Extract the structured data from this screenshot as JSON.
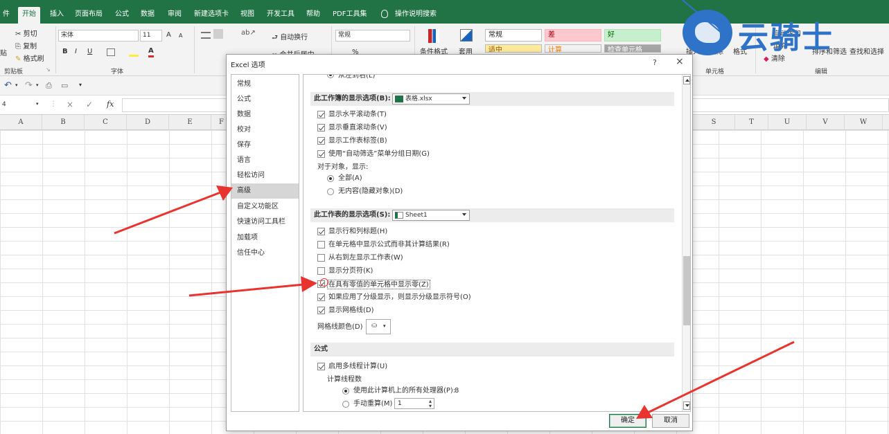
{
  "tabs": [
    "件",
    "开始",
    "插入",
    "页面布局",
    "公式",
    "数据",
    "审阅",
    "新建选项卡",
    "视图",
    "开发工具",
    "帮助",
    "PDF工具集",
    "操作说明搜索"
  ],
  "ribbon": {
    "clipboard": {
      "cut": "剪切",
      "copy": "复制",
      "paint": "格式刷",
      "paste": "贴",
      "group": "剪贴板"
    },
    "font": {
      "name": "宋体",
      "size": "11",
      "bold": "B",
      "italic": "I",
      "underline": "U",
      "font_color": "A",
      "grow": "A",
      "shrink": "A",
      "group": "字体"
    },
    "alignment": {
      "wrap": "自动换行",
      "merge": "合并后居中"
    },
    "number": {
      "format": "常规",
      "pct": "%"
    },
    "cond_format": "条件格式",
    "table_format": "套用",
    "styles": {
      "normal": "常规",
      "bad": "差",
      "good": "好",
      "neutral": "适中",
      "calc": "计算",
      "check": "检查单元格"
    },
    "cells": {
      "insert": "插入",
      "delete": "删除",
      "format": "格式",
      "group": "单元格"
    },
    "editing": {
      "autosum": "自动求和",
      "fill": "填充",
      "clear": "清除",
      "sort": "排序和筛选",
      "find": "查找和选择",
      "group": "编辑"
    }
  },
  "namebox": "4",
  "formula_symbols": {
    "cancel": "×",
    "enter": "✓",
    "fx": "fx"
  },
  "columns": [
    "A",
    "B",
    "C",
    "D",
    "E",
    "F",
    "S",
    "T",
    "U",
    "V",
    "W"
  ],
  "dialog": {
    "title": "Excel 选项",
    "help": "?",
    "close": "×",
    "nav": [
      "常规",
      "公式",
      "数据",
      "校对",
      "保存",
      "语言",
      "轻松访问",
      "高级",
      "自定义功能区",
      "快速访问工具栏",
      "加载项",
      "信任中心"
    ],
    "selected_nav": "高级",
    "top_cut": "从左到右(L)",
    "workbook_section": {
      "label": "此工作簿的显示选项(B):",
      "value": "表格.xlsx"
    },
    "workbook_options": [
      {
        "label": "显示水平滚动条(T)",
        "checked": true
      },
      {
        "label": "显示垂直滚动条(V)",
        "checked": true
      },
      {
        "label": "显示工作表标签(B)",
        "checked": true
      },
      {
        "label": "使用“自动筛选”菜单分组日期(G)",
        "checked": true
      }
    ],
    "objects_label": "对于对象，显示:",
    "objects_options": [
      {
        "label": "全部(A)",
        "checked": true
      },
      {
        "label": "无内容(隐藏对象)(D)",
        "checked": false
      }
    ],
    "sheet_section": {
      "label": "此工作表的显示选项(S):",
      "value": "Sheet1"
    },
    "sheet_options": [
      {
        "label": "显示行和列标题(H)",
        "checked": true
      },
      {
        "label": "在单元格中显示公式而非其计算结果(R)",
        "checked": false
      },
      {
        "label": "从右到左显示工作表(W)",
        "checked": false
      },
      {
        "label": "显示分页符(K)",
        "checked": false
      },
      {
        "label": "在具有零值的单元格中显示零(Z)",
        "checked": true
      },
      {
        "label": "如果应用了分级显示，则显示分级显示符号(O)",
        "checked": true
      },
      {
        "label": "显示网格线(D)",
        "checked": true
      }
    ],
    "gridline_color_label": "网格线颜色(D)",
    "formula_section": "公式",
    "multithread": {
      "label": "启用多线程计算(U)",
      "checked": true
    },
    "thread_count_label": "计算线程数",
    "processors": {
      "label": "使用此计算机上的所有处理器(P):",
      "value": "8",
      "checked": true
    },
    "manual": {
      "label": "手动重算(M)",
      "value": "1",
      "checked": false
    },
    "ok": "确定",
    "cancel": "取消"
  },
  "watermark": "云骑士",
  "colors": {
    "excel_green": "#217346",
    "arrow_red": "#e8332e",
    "watermark_blue": "#2f73c9"
  }
}
